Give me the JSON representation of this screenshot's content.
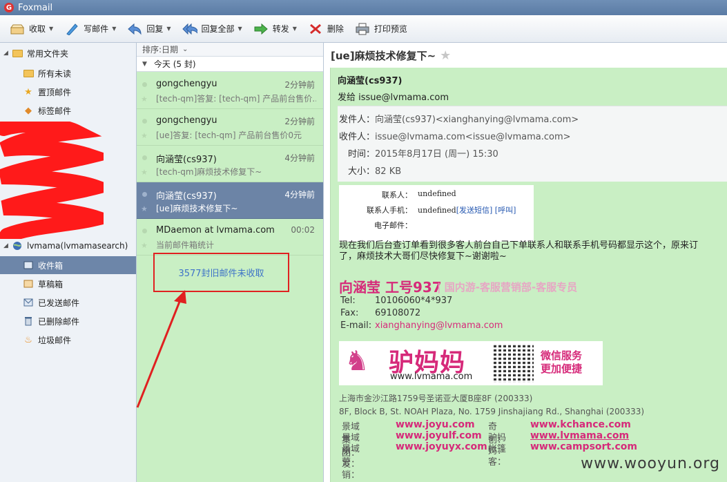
{
  "window": {
    "title": "Foxmail"
  },
  "toolbar": [
    {
      "label": "收取",
      "icon": "inbox-tray-icon",
      "caret": true
    },
    {
      "label": "写邮件",
      "icon": "pen-icon",
      "caret": true
    },
    {
      "label": "回复",
      "icon": "reply-icon",
      "caret": true
    },
    {
      "label": "回复全部",
      "icon": "reply-all-icon",
      "caret": true
    },
    {
      "label": "转发",
      "icon": "forward-icon",
      "caret": true
    },
    {
      "label": "删除",
      "icon": "delete-icon",
      "caret": false
    },
    {
      "label": "打印预览",
      "icon": "printer-icon",
      "caret": false
    }
  ],
  "sidebar": {
    "common_group": "常用文件夹",
    "common_items": [
      "所有未读",
      "置顶邮件",
      "标签邮件"
    ],
    "account": "lvmama(lvmamasearch)",
    "account_items": [
      "收件箱",
      "草稿箱",
      "已发送邮件",
      "已删除邮件",
      "垃圾邮件"
    ],
    "selected": "收件箱"
  },
  "maillist": {
    "sort_label": "排序:日期",
    "group_label": "今天 (5 封)",
    "mails": [
      {
        "from": "gongchengyu",
        "time": "2分钟前",
        "subject": "[tech-qm]答复: [tech-qm] 产品前台售价..."
      },
      {
        "from": "gongchengyu",
        "time": "2分钟前",
        "subject": "[ue]答复: [tech-qm] 产品前台售价0元"
      },
      {
        "from": "向涵莹(cs937)",
        "time": "4分钟前",
        "subject": "[tech-qm]麻烦技术修复下~"
      },
      {
        "from": "向涵莹(cs937)",
        "time": "4分钟前",
        "subject": "[ue]麻烦技术修复下~"
      },
      {
        "from": "MDaemon at lvmama.com",
        "time": "00:02",
        "subject": "当前邮件箱统计"
      }
    ],
    "old_mail_notice": "3577封旧邮件未收取",
    "annotation_color": "#e02020"
  },
  "reader": {
    "subject": "[ue]麻烦技术修复下~",
    "sender_name": "向涵莹(cs937)",
    "sent_to": "发给 issue@lvmama.com",
    "headers": {
      "from_label": "发件人：",
      "from_value": "向涵莹(cs937)<xianghanying@lvmama.com>",
      "to_label": "收件人：",
      "to_value": "issue@lvmama.com<issue@lvmama.com>",
      "time_label": "时间：",
      "time_value": "2015年8月17日 (周一) 15:30",
      "size_label": "大小：",
      "size_value": "82 KB"
    },
    "info": {
      "contact_label": "联系人：",
      "contact_value": "undefined",
      "phone_label": "联系人手机：",
      "phone_value": "undefined",
      "send_sms": "[发送短信]",
      "call": "[呼叫]",
      "email_label": "电子邮件："
    },
    "message_line1": "现在我们后台查订单看到很多客人前台自己下单联系人和联系手机号码都显示这个，原来订",
    "message_line2": "了，麻烦技术大哥们尽快修复下~谢谢啦~",
    "signature": {
      "name": "向涵莹 工号937",
      "dept": "| 国内游-客服营销部-客服专员",
      "tel_label": "Tel:",
      "tel": "10106060*4*937",
      "fax_label": "Fax:",
      "fax": "69108072",
      "email_label": "E-mail:",
      "email": "xianghanying@lvmama.com"
    },
    "banner": {
      "brand": "驴妈妈",
      "url": "www.lvmama.com",
      "wechat_line1": "微信服务",
      "wechat_line2": "更加便捷"
    },
    "address_cn": "上海市金沙江路1759号圣诺亚大厦B座8F (200333)",
    "address_en": "8F, Block B, St. NOAH Plaza, No. 1759 Jinshajiang Rd., Shanghai (200333)",
    "sites": [
      {
        "k": "景域集团：",
        "v": "www.joyu.com",
        "k2": "奇创：",
        "v2": "www.kchance.com"
      },
      {
        "k": "景域旅发：",
        "v": "www.joyulf.com",
        "k2": "驴妈妈：",
        "v2": "www.lvmama.com"
      },
      {
        "k": "景域营销：",
        "v": "www.joyuyx.com",
        "k2": "帐篷客：",
        "v2": "www.campsort.com"
      }
    ],
    "accent_color": "#d62a7a"
  },
  "watermark": "www.wooyun.org"
}
